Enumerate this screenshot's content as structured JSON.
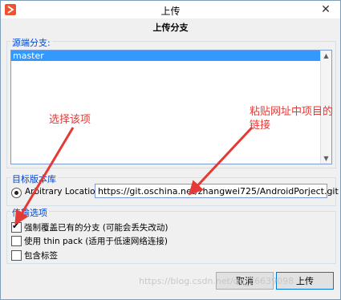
{
  "window": {
    "title": "上传",
    "close_glyph": "✕"
  },
  "dialog": {
    "heading": "上传分支"
  },
  "source_branch": {
    "group_label": "源端分支:",
    "items": [
      "master"
    ],
    "selected": "master"
  },
  "target_repo": {
    "group_label": "目标版本库",
    "option_label": "Arbitrary Location:",
    "url_value": "https://git.oschina.net/zhangwei725/AndroidPorject.git"
  },
  "push_options": {
    "group_label": "传输选项",
    "options": [
      {
        "label": "强制覆盖已有的分支 (可能会丢失改动)",
        "checked": true
      },
      {
        "label": "使用 thin pack (适用于低速网络连接)",
        "checked": false
      },
      {
        "label": "包含标签",
        "checked": false
      }
    ]
  },
  "buttons": {
    "cancel": "取消",
    "upload": "上传"
  },
  "annotations": {
    "select_item": "选择该项",
    "paste_url": "粘贴网址中项目的链接"
  },
  "watermark": "https://blog.csdn.net/qq_36639098",
  "colors": {
    "accent": "#0046d5",
    "selection": "#3399ff",
    "annotation": "#e53935"
  }
}
